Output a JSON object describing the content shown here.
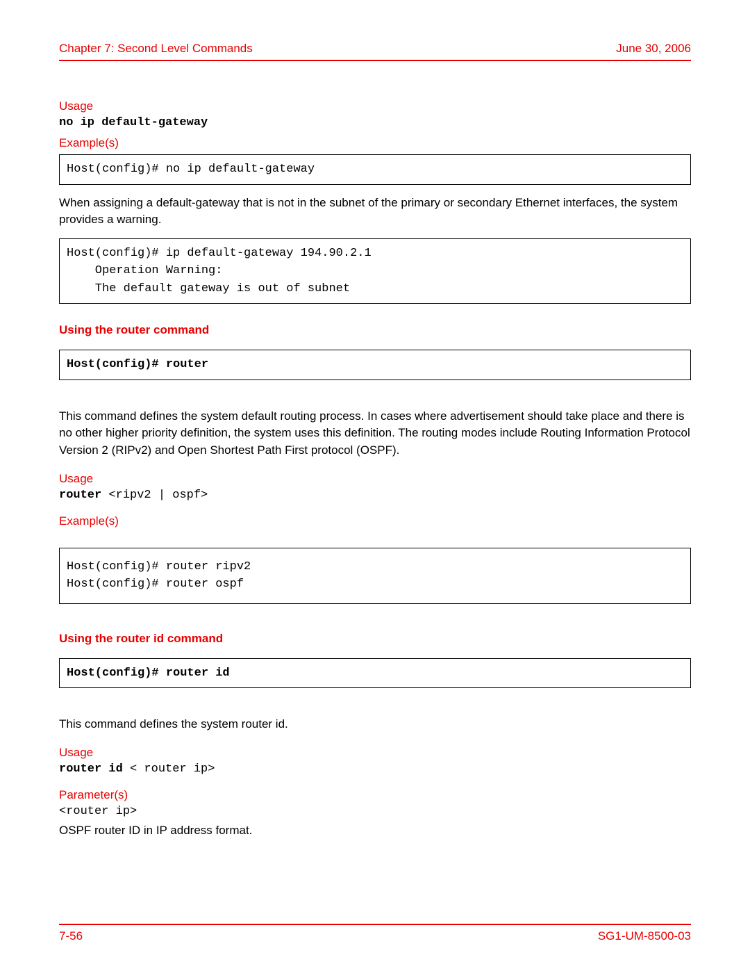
{
  "header": {
    "left": "Chapter 7: Second Level Commands",
    "right": "June 30, 2006"
  },
  "sections": {
    "no_ip": {
      "usage_label": "Usage",
      "usage_cmd": "no ip default-gateway",
      "examples_label": "Example(s)",
      "example_box": "Host(config)# no ip default-gateway",
      "paragraph": "When assigning a default-gateway that is not in the subnet of the primary or secondary Ethernet interfaces, the system provides a warning.",
      "warning_box": "Host(config)# ip default-gateway 194.90.2.1\n    Operation Warning:\n    The default gateway is out of subnet"
    },
    "router": {
      "heading": "Using the router command",
      "cmd_box": "Host(config)# router",
      "paragraph": "This command defines the system default routing process. In cases where advertisement should take place and there is no other higher priority definition, the system uses this definition. The routing modes include Routing Information Protocol Version 2 (RIPv2) and Open Shortest Path First protocol (OSPF).",
      "usage_label": "Usage",
      "usage_cmd_bold": "router ",
      "usage_cmd_rest": "<ripv2 | ospf>",
      "examples_label": "Example(s)",
      "example_box": "Host(config)# router ripv2\nHost(config)# router ospf"
    },
    "router_id": {
      "heading": "Using the router id command",
      "cmd_box": "Host(config)# router id",
      "paragraph": "This command defines the system router id.",
      "usage_label": "Usage",
      "usage_cmd_bold": "router id",
      "usage_cmd_rest": " < router ip>",
      "params_label": "Parameter(s)",
      "param_name": "<router ip>",
      "param_desc": "OSPF router ID in IP address format."
    }
  },
  "footer": {
    "left": "7-56",
    "right": "SG1-UM-8500-03"
  }
}
